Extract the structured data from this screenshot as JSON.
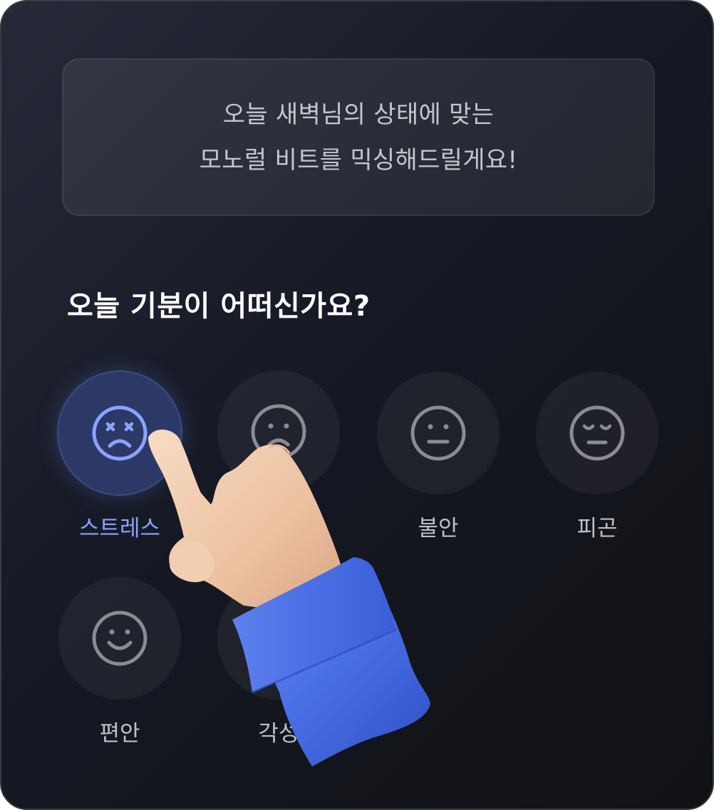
{
  "banner": {
    "line1": "오늘 새벽님의 상태에 맞는",
    "line2": "모노럴 비트를 믹싱해드릴게요!"
  },
  "question": "오늘 기분이 어떠신가요?",
  "moods": [
    {
      "label": "스트레스",
      "icon": "stressed-face-icon",
      "selected": true
    },
    {
      "label": "",
      "icon": "sad-face-icon",
      "selected": false
    },
    {
      "label": "불안",
      "icon": "neutral-face-icon",
      "selected": false
    },
    {
      "label": "피곤",
      "icon": "tired-face-icon",
      "selected": false
    },
    {
      "label": "편안",
      "icon": "smile-face-icon",
      "selected": false
    },
    {
      "label": "각성",
      "icon": "awake-face-icon",
      "selected": false
    }
  ],
  "colors": {
    "accent": "#8aa3ff",
    "selected_bg": "#2c3967",
    "icon_stroke": "#8b8c91",
    "sleeve": "#4a70e6",
    "skin": "#f0c8a8"
  }
}
